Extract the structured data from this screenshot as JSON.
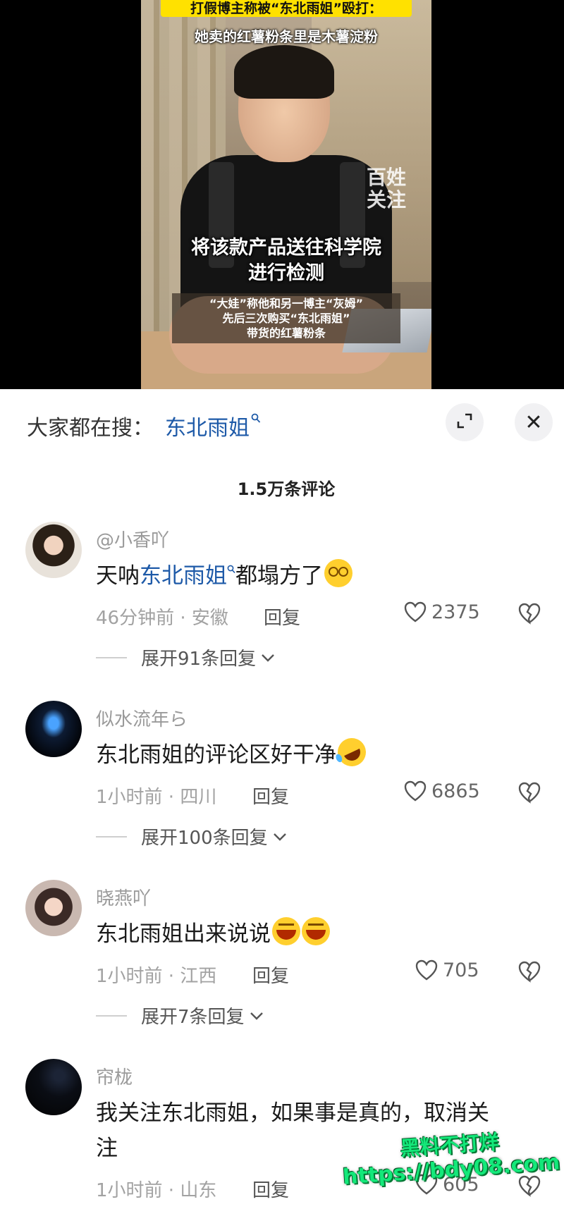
{
  "video": {
    "caption_top": "打假博主称被“东北雨姐”殴打：",
    "caption_top2": "她卖的红薯粉条里是木薯淀粉",
    "caption_main_1": "将该款产品送往科学院",
    "caption_main_2": "进行检测",
    "caption_sub_1": "“大娃”称他和另一博主“灰姆”",
    "caption_sub_2": "先后三次购买“东北雨姐”",
    "caption_sub_3": "带货的红薯粉条",
    "logo_line1": "百姓",
    "logo_line2": "关注"
  },
  "sheet": {
    "search_prefix": "大家都在搜：",
    "search_keyword": "东北雨姐",
    "comments_count": "1.5万条评论",
    "close_symbol": "✕"
  },
  "comments": [
    {
      "username": "@小香吖",
      "keyword": "东北雨姐",
      "text_before": "天呐",
      "text_after": "都塌方了",
      "emoji": "dizzy-face",
      "meta": "46分钟前 · 安徽",
      "reply": "回复",
      "likes": "2375",
      "expand": "展开91条回复"
    },
    {
      "username": "似水流年ら",
      "text": "东北雨姐的评论区好干净",
      "emoji": "rofl-face",
      "meta": "1小时前 · 四川",
      "reply": "回复",
      "likes": "6865",
      "expand": "展开100条回复"
    },
    {
      "username": "晓燕吖",
      "text": "东北雨姐出来说说",
      "emoji": "grinning-squint-face",
      "meta": "1小时前 · 江西",
      "reply": "回复",
      "likes": "705",
      "expand": "展开7条回复"
    },
    {
      "username": "帘栊",
      "text_line1": "我关注东北雨姐，如果事是真的，取消关",
      "text_line2": "注",
      "meta": "1小时前 · 山东",
      "reply": "回复",
      "likes": "605"
    }
  ],
  "watermark": {
    "line1": "黑料不打烊",
    "line2": "https://bdy08.com"
  },
  "colors": {
    "keyword_blue": "#1e5aa8",
    "caption_yellow": "#ffe100",
    "watermark_green": "#14e87a"
  }
}
